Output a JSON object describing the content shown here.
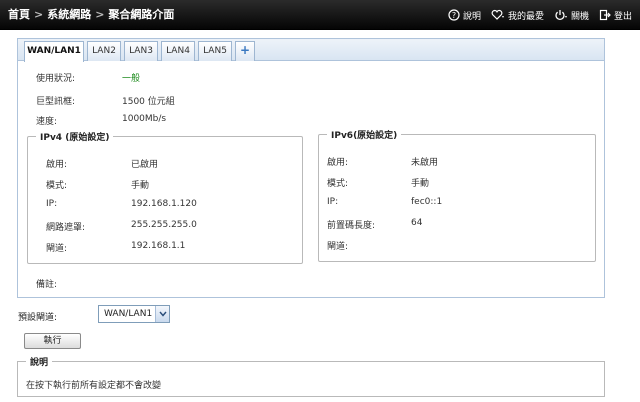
{
  "breadcrumb": {
    "home": "首頁",
    "sep1": ">",
    "level1": "系統網路",
    "sep2": ">",
    "level2": "聚合網路介面"
  },
  "toplinks": {
    "help": "說明",
    "favorites": "我的最愛",
    "shutdown": "關機",
    "logout": "登出"
  },
  "tabs": [
    "WAN/LAN1",
    "LAN2",
    "LAN3",
    "LAN4",
    "LAN5",
    "+"
  ],
  "active_tab": 0,
  "status": {
    "usage_label": "使用狀況:",
    "usage_value": "一般",
    "jumbo_label": "巨型訊框:",
    "jumbo_value": "1500 位元組",
    "speed_label": "速度:",
    "speed_value": "1000Mb/s"
  },
  "ipv4": {
    "legend": "IPv4 (原始設定)",
    "enable_label": "啟用:",
    "enable_value": "已啟用",
    "mode_label": "模式:",
    "mode_value": "手動",
    "ip_label": "IP:",
    "ip_value": "192.168.1.120",
    "mask_label": "網路遮罩:",
    "mask_value": "255.255.255.0",
    "gateway_label": "閘道:",
    "gateway_value": "192.168.1.1"
  },
  "ipv6": {
    "legend": "IPv6(原始設定)",
    "enable_label": "啟用:",
    "enable_value": "未啟用",
    "mode_label": "模式:",
    "mode_value": "手動",
    "ip_label": "IP:",
    "ip_value": "fec0::1",
    "prefix_label": "前置碼長度:",
    "prefix_value": "64",
    "gateway_label": "閘道:",
    "gateway_value": ""
  },
  "remark_label": "備註:",
  "default_gateway": {
    "label": "預設閘道:",
    "selected": "WAN/LAN1"
  },
  "apply_button": "執行",
  "note": {
    "legend": "說明",
    "text": "在按下執行前所有設定都不會改變"
  },
  "colors": {
    "header_bg": "#111111",
    "tab_border": "#aec3db",
    "status_ok": "#1b8a1b"
  }
}
